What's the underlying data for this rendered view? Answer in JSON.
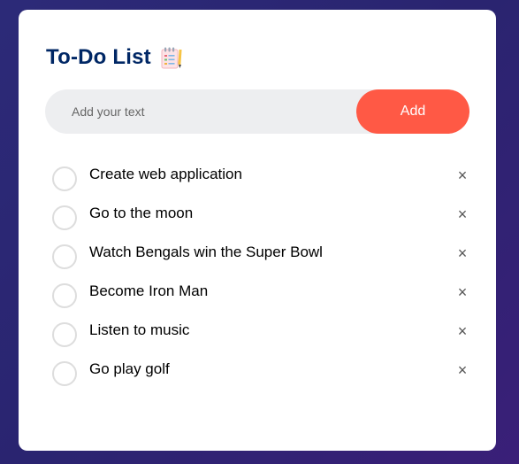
{
  "app": {
    "title": "To-Do List",
    "title_icon": "notepad-emoji-icon"
  },
  "input": {
    "placeholder": "Add your text",
    "value": ""
  },
  "add_button": {
    "label": "Add"
  },
  "tasks": [
    {
      "label": "Create web application",
      "checked": false
    },
    {
      "label": "Go to the moon",
      "checked": false
    },
    {
      "label": "Watch Bengals win the Super Bowl",
      "checked": false
    },
    {
      "label": "Become Iron Man",
      "checked": false
    },
    {
      "label": "Listen to music",
      "checked": false
    },
    {
      "label": "Go play golf",
      "checked": false
    }
  ],
  "remove_glyph": "×",
  "colors": {
    "background_start": "#2c2a78",
    "background_end": "#3a1f78",
    "card": "#ffffff",
    "title": "#002765",
    "accent": "#ff5945",
    "input_bg": "#edeef0",
    "checkbox_border": "#dddddd"
  }
}
